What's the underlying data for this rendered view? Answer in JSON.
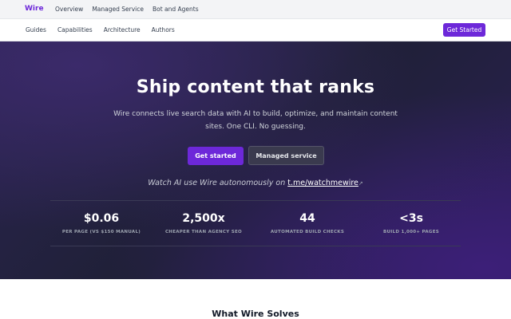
{
  "topbar": {
    "brand": "Wire",
    "links": [
      "Overview",
      "Managed Service",
      "Bot and Agents"
    ]
  },
  "subbar": {
    "links": [
      "Guides",
      "Capabilities",
      "Architecture",
      "Authors"
    ],
    "cta": "Get Started"
  },
  "hero": {
    "title": "Ship content that ranks",
    "subtitle": "Wire connects live search data with AI to build, optimize, and maintain content sites. One CLI. No guessing.",
    "primary_button": "Get started",
    "secondary_button": "Managed service",
    "watch_prefix": "Watch AI use Wire autonomously on ",
    "watch_link": "t.me/watchmewire",
    "watch_icon": "↗",
    "stats": [
      {
        "value": "$0.06",
        "label": "PER PAGE (VS $150 MANUAL)"
      },
      {
        "value": "2,500x",
        "label": "CHEAPER THAN AGENCY SEO"
      },
      {
        "value": "44",
        "label": "AUTOMATED BUILD CHECKS"
      },
      {
        "value": "<3s",
        "label": "BUILD 1,000+ PAGES"
      }
    ]
  },
  "section": {
    "title": "What Wire Solves"
  },
  "colors": {
    "accent": "#6d28d9",
    "hero_bg": "#1f2036"
  }
}
